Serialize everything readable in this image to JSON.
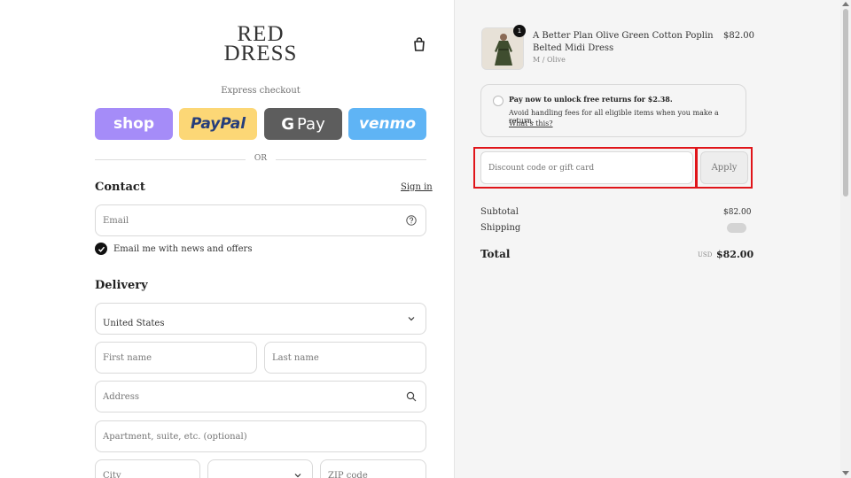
{
  "brand": {
    "line1": "RED",
    "line2": "DRESS"
  },
  "express": {
    "label": "Express checkout",
    "buttons": {
      "shop": "shop",
      "paypal": "PayPal",
      "gpay_g": "G",
      "gpay": "Pay",
      "venmo": "venmo"
    },
    "or_label": "OR"
  },
  "contact": {
    "title": "Contact",
    "signin": "Sign in",
    "email_placeholder": "Email",
    "newsletter_label": "Email me with news and offers"
  },
  "delivery": {
    "title": "Delivery",
    "country": "United States",
    "first_name_placeholder": "First name",
    "last_name_placeholder": "Last name",
    "address_placeholder": "Address",
    "apartment_placeholder": "Apartment, suite, etc. (optional)",
    "city_placeholder": "City",
    "zip_placeholder": "ZIP code"
  },
  "order": {
    "quantity": "1",
    "product_name": "A Better Plan Olive Green Cotton Poplin Belted Midi Dress",
    "variant": "M / Olive",
    "price": "$82.00"
  },
  "returns": {
    "title": "Pay now to unlock free returns for $2.38.",
    "desc": "Avoid handling fees for all eligible items when you make a return.",
    "link": "What's this?"
  },
  "discount": {
    "placeholder": "Discount code or gift card",
    "apply_label": "Apply"
  },
  "summary": {
    "subtotal_label": "Subtotal",
    "subtotal": "$82.00",
    "shipping_label": "Shipping",
    "total_label": "Total",
    "currency": "USD",
    "total": "$82.00"
  },
  "colors": {
    "highlight": "#e0151a",
    "shop": "#a58cf8",
    "paypal": "#fcd776",
    "gpay": "#5d5d5d",
    "venmo": "#5fb4f5"
  }
}
